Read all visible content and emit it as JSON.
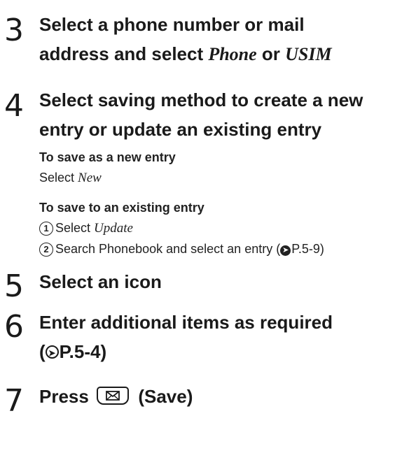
{
  "step3": {
    "number": "3",
    "line1": "Select a phone number or mail",
    "line2_prefix": "address and select ",
    "option_a": "Phone",
    "connector": " or ",
    "option_b": "USIM"
  },
  "step4": {
    "number": "4",
    "line1": "Select saving method to create a new",
    "line2": "entry or update an existing entry",
    "new_entry_heading": "To save as a new entry",
    "new_entry_prefix": "Select ",
    "new_entry_option": "New",
    "existing_heading": "To save to an existing entry",
    "sub1_marker": "1",
    "sub1_prefix": "Select ",
    "sub1_option": "Update",
    "sub2_marker": "2",
    "sub2_text": "Search Phonebook and select an entry (",
    "sub2_ref": "P.5-9",
    "sub2_close": ")"
  },
  "step5": {
    "number": "5",
    "title": "Select an icon"
  },
  "step6": {
    "number": "6",
    "line1": "Enter additional items as required",
    "ref_open": "(",
    "ref": "P.5-4",
    "ref_close": ")"
  },
  "step7": {
    "number": "7",
    "prefix": "Press",
    "key_icon": "mail-key-icon",
    "suffix": "(Save)"
  }
}
